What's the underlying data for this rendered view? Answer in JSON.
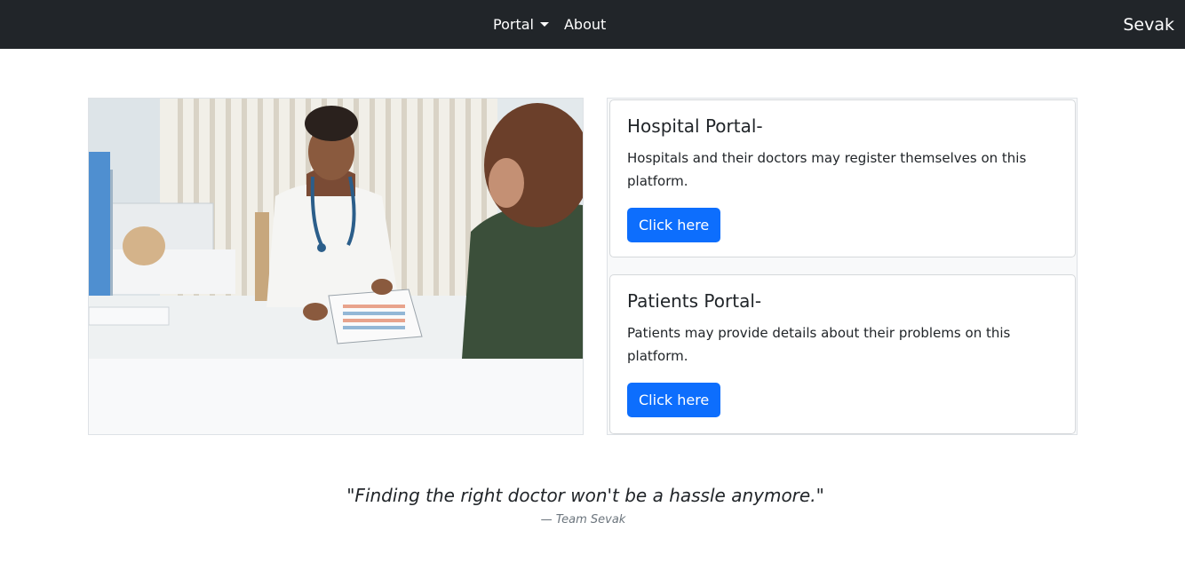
{
  "nav": {
    "portal_label": "Portal",
    "about_label": "About",
    "brand": "Sevak"
  },
  "hospital_card": {
    "title": "Hospital Portal-",
    "text": "Hospitals and their doctors may register themselves on this platform.",
    "button_label": "Click here"
  },
  "patients_card": {
    "title": "Patients Portal-",
    "text": "Patients may provide details about their problems on this platform.",
    "button_label": "Click here"
  },
  "quote": {
    "text": "\"Finding the right doctor won't be a hassle anymore.\"",
    "attribution": "— Team Sevak"
  },
  "colors": {
    "navbar_bg": "#212529",
    "button_primary": "#0d6efd",
    "panel_bg": "#f8f9fa"
  },
  "icons": {
    "portal_dropdown": "caret-down-icon"
  }
}
